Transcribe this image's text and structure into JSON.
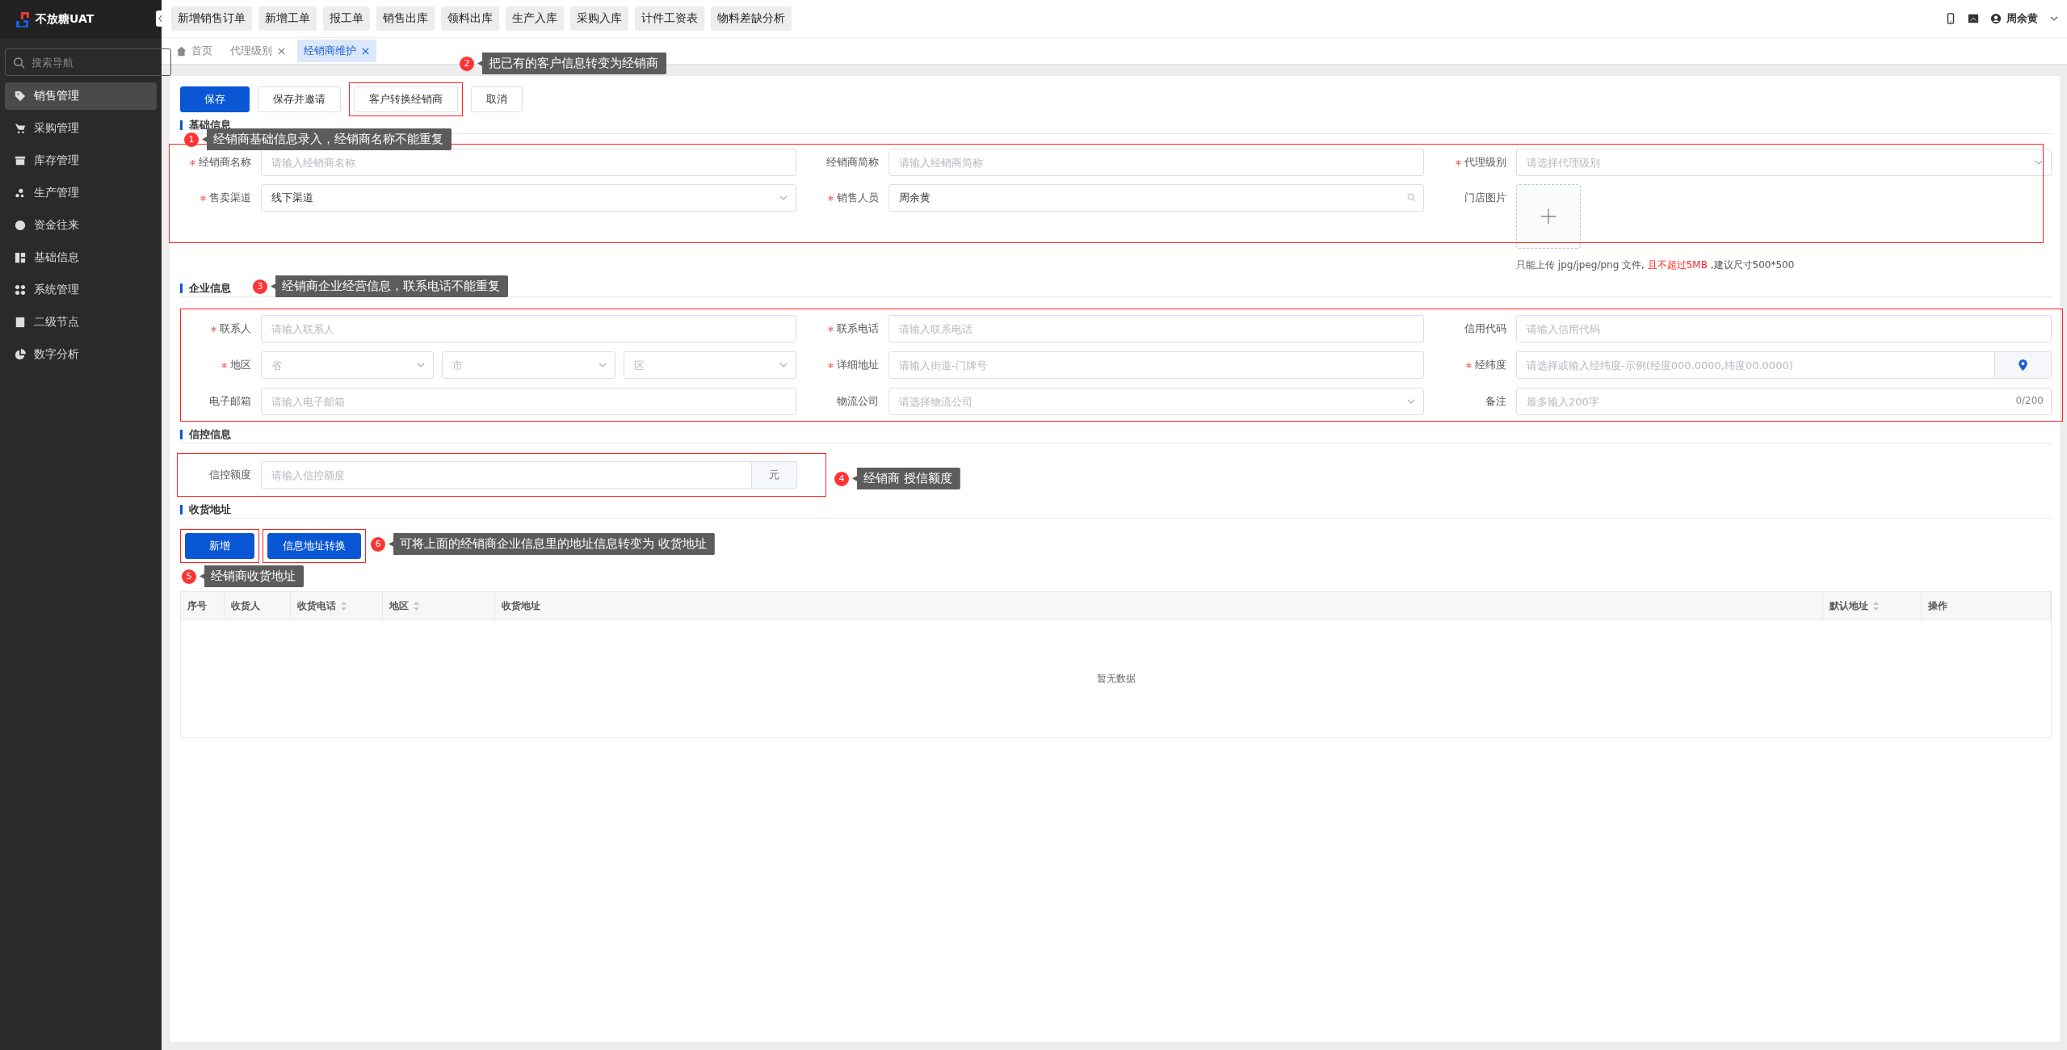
{
  "app": {
    "name": "不放糖UAT"
  },
  "sidebar": {
    "search": {
      "placeholder": "搜索导航"
    },
    "items": [
      {
        "label": "销售管理",
        "selected": true
      },
      {
        "label": "采购管理",
        "selected": false
      },
      {
        "label": "库存管理",
        "selected": false
      },
      {
        "label": "生产管理",
        "selected": false
      },
      {
        "label": "资金往来",
        "selected": false
      },
      {
        "label": "基础信息",
        "selected": false
      },
      {
        "label": "系统管理",
        "selected": false
      },
      {
        "label": "二级节点",
        "selected": false
      },
      {
        "label": "数字分析",
        "selected": false
      }
    ]
  },
  "quick_links": [
    "新增销售订单",
    "新增工单",
    "报工单",
    "销售出库",
    "领料出库",
    "生产入库",
    "采购入库",
    "计件工资表",
    "物料差缺分析"
  ],
  "user": {
    "name": "周余黄"
  },
  "tabs": [
    {
      "label": "首页",
      "closable": false,
      "selected": false
    },
    {
      "label": "代理级别",
      "closable": true,
      "selected": false
    },
    {
      "label": "经销商维护",
      "closable": true,
      "selected": true
    }
  ],
  "actions": [
    {
      "label": "保存",
      "kind": "primary",
      "highlighted": false
    },
    {
      "label": "保存并邀请",
      "kind": "default",
      "highlighted": false
    },
    {
      "label": "客户转换经销商",
      "kind": "default",
      "highlighted": true,
      "annotation": {
        "number": "2",
        "text": "把已有的客户信息转变为经销商"
      }
    },
    {
      "label": "取消",
      "kind": "default",
      "highlighted": false
    }
  ],
  "sections": [
    {
      "title": "基础信息",
      "highlighted": true,
      "annotation": {
        "number": "1",
        "text": "经销商基础信息录入，经销商名称不能重复"
      },
      "fields": [
        {
          "label": "经销商名称",
          "required": true,
          "kind": "input",
          "placeholder": "请输入经销商名称"
        },
        {
          "label": "经销商简称",
          "required": false,
          "kind": "input",
          "placeholder": "请输入经销商简称"
        },
        {
          "label": "代理级别",
          "required": true,
          "kind": "select",
          "placeholder": "请选择代理级别"
        },
        {
          "label": "售卖渠道",
          "required": true,
          "kind": "select",
          "value": "线下渠道"
        },
        {
          "label": "销售人员",
          "required": true,
          "kind": "search",
          "value": "周余黄"
        },
        {
          "label": "门店图片",
          "required": false,
          "kind": "upload",
          "hint": [
            {
              "text": "只能上传 jpg/jpeg/png 文件, ",
              "emphasis": false
            },
            {
              "text": "且不超过5MB",
              "emphasis": true
            },
            {
              "text": " ,建议尺寸500*500",
              "emphasis": false
            }
          ]
        }
      ]
    },
    {
      "title": "企业信息",
      "highlighted": true,
      "annotation": {
        "number": "3",
        "text": "经销商企业经营信息，联系电话不能重复"
      },
      "fields": [
        {
          "label": "联系人",
          "required": true,
          "kind": "input",
          "placeholder": "请输入联系人"
        },
        {
          "label": "联系电话",
          "required": true,
          "kind": "input",
          "placeholder": "请输入联系电话"
        },
        {
          "label": "信用代码",
          "required": false,
          "kind": "input",
          "placeholder": "请输入信用代码"
        },
        {
          "label": "地区",
          "required": true,
          "kind": "region",
          "parts": [
            {
              "placeholder": "省"
            },
            {
              "placeholder": "市"
            },
            {
              "placeholder": "区"
            }
          ]
        },
        {
          "label": "详细地址",
          "required": true,
          "kind": "input",
          "placeholder": "请输入街道-门牌号"
        },
        {
          "label": "经纬度",
          "required": true,
          "kind": "location",
          "placeholder": "请选择或输入经纬度-示例(经度000.0000,纬度00.0000)"
        },
        {
          "label": "电子邮箱",
          "required": false,
          "kind": "input",
          "placeholder": "请输入电子邮箱"
        },
        {
          "label": "物流公司",
          "required": false,
          "kind": "select",
          "placeholder": "请选择物流公司"
        },
        {
          "label": "备注",
          "required": false,
          "kind": "counter",
          "placeholder": "最多输入200字",
          "counter": "0/200"
        }
      ]
    },
    {
      "title": "信控信息",
      "highlighted": true,
      "annotation": {
        "number": "4",
        "text": "经销商 授信额度"
      },
      "fields": [
        {
          "label": "信控额度",
          "required": false,
          "kind": "addon",
          "placeholder": "请输入信控额度",
          "addon": "元"
        }
      ]
    }
  ],
  "address": {
    "title": "收货地址",
    "buttons": [
      {
        "label": "新增",
        "highlighted": true,
        "annotation": {
          "number": "5",
          "text": "经销商收货地址"
        }
      },
      {
        "label": "信息地址转换",
        "highlighted": true,
        "annotation": {
          "number": "6",
          "text": "可将上面的经销商企业信息里的地址信息转变为 收货地址"
        }
      }
    ],
    "table": {
      "columns": [
        {
          "label": "序号",
          "sortable": false
        },
        {
          "label": "收货人",
          "sortable": false
        },
        {
          "label": "收货电话",
          "sortable": true
        },
        {
          "label": "地区",
          "sortable": true
        },
        {
          "label": "收货地址",
          "sortable": false
        },
        {
          "label": "默认地址",
          "sortable": true
        },
        {
          "label": "操作",
          "sortable": false
        }
      ],
      "empty_text": "暂无数据"
    }
  }
}
